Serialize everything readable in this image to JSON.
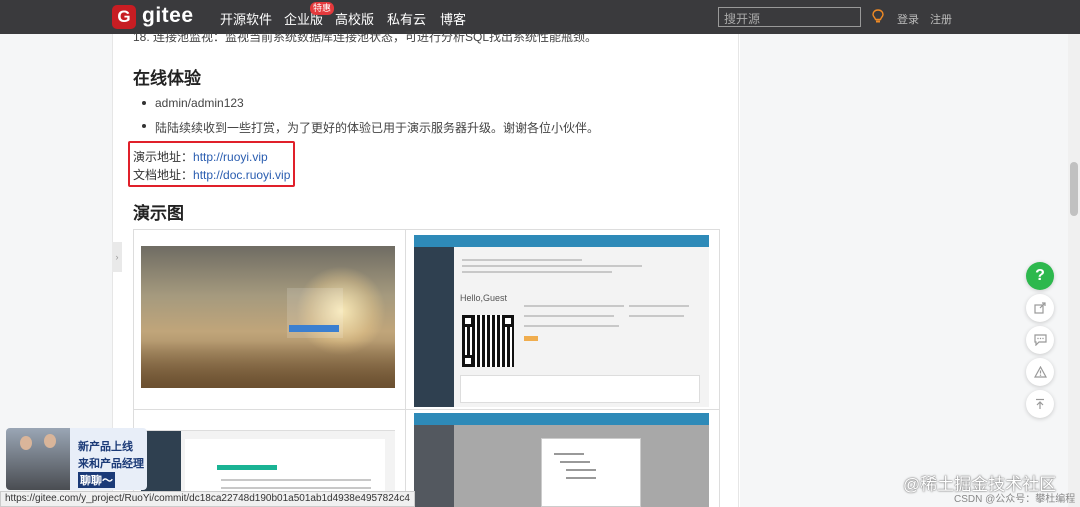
{
  "topbar": {
    "logo_letter": "G",
    "brand": "gitee",
    "nav": [
      "开源软件",
      "企业版",
      "高校版",
      "私有云",
      "博客"
    ],
    "badge": "特惠",
    "search_placeholder": "搜开源",
    "login": "登录",
    "register": "注册"
  },
  "content": {
    "cut_line": "18. 连接池监视：监视当前系统数据库连接池状态，可进行分析SQL找出系统性能瓶颈。",
    "section1_title": "在线体验",
    "list_items": [
      "admin/admin123",
      "陆陆续续收到一些打赏，为了更好的体验已用于演示服务器升级。谢谢各位小伙伴。"
    ],
    "demo_label": "演示地址：",
    "demo_url": "http://ruoyi.vip",
    "doc_label": "文档地址：",
    "doc_url": "http://doc.ruoyi.vip",
    "section2_title": "演示图"
  },
  "screenshots": {
    "admin_hello": "Hello,Guest"
  },
  "float_buttons": [
    "?",
    "share-icon",
    "comment-icon",
    "warning-icon",
    "back-to-top-icon"
  ],
  "promo": {
    "line1": "新产品上线",
    "line2": "来和产品经理",
    "line3": "聊聊～"
  },
  "statusbar": {
    "url": "https://gitee.com/y_project/RuoYi/commit/dc18ca22748d190b01a501ab1d4938e4957824c4"
  },
  "watermark": {
    "line1": "@稀土掘金技术社区",
    "line2": "CSDN @公众号：攀杜编程"
  },
  "colors": {
    "topbar": "#3a3a3d",
    "logo": "#c71d23",
    "highlight": "#e0202a",
    "link": "#2a5db0",
    "help": "#2db84d"
  }
}
